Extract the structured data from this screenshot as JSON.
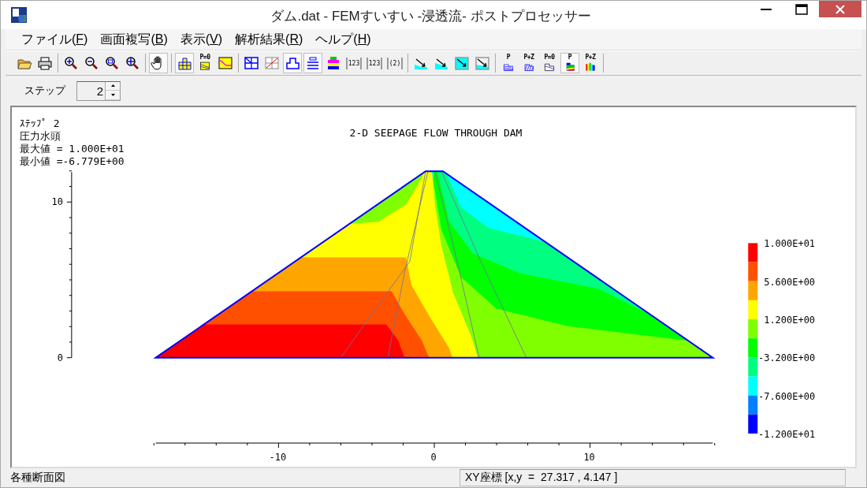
{
  "window": {
    "title": "ダム.dat - FEMすいすい -浸透流- ポストプロセッサー"
  },
  "menu": [
    {
      "before": "ファイル(",
      "key": "F",
      "after": ")"
    },
    {
      "before": "画面複写(",
      "key": "B",
      "after": ")"
    },
    {
      "before": "表示(",
      "key": "V",
      "after": ")"
    },
    {
      "before": "解析結果(",
      "key": "R",
      "after": ")"
    },
    {
      "before": "ヘルプ(",
      "key": "H",
      "after": ")"
    }
  ],
  "toolbar": [
    [
      {
        "kind": "open",
        "pressed": false
      },
      {
        "kind": "print",
        "pressed": false
      }
    ],
    [
      {
        "kind": "zoom-in",
        "pressed": false
      },
      {
        "kind": "zoom-out",
        "pressed": false
      },
      {
        "kind": "zoom-box",
        "pressed": false
      },
      {
        "kind": "zoom-fit",
        "pressed": false
      }
    ],
    [
      {
        "kind": "pan",
        "pressed": true
      }
    ],
    [
      {
        "kind": "mesh",
        "pressed": true
      },
      {
        "kind": "section",
        "label": "P=0",
        "pressed": false
      },
      {
        "kind": "graph",
        "pressed": false
      }
    ],
    [
      {
        "kind": "grid",
        "pressed": false
      },
      {
        "kind": "crossed-grid",
        "pressed": false
      },
      {
        "kind": "outline",
        "pressed": true
      },
      {
        "kind": "layers",
        "pressed": true
      },
      {
        "kind": "color-layers",
        "pressed": false
      },
      {
        "kind": "numbers",
        "label": "123",
        "pressed": false
      },
      {
        "kind": "numbers",
        "label": "123",
        "pressed": false
      },
      {
        "kind": "numbers",
        "label": "(2)",
        "pressed": false
      }
    ],
    [
      {
        "kind": "flow",
        "pressed": false
      },
      {
        "kind": "flow",
        "pressed": false
      },
      {
        "kind": "flow",
        "pressed": false
      },
      {
        "kind": "flow",
        "pressed": false
      }
    ],
    [
      {
        "kind": "hatch",
        "label": "P",
        "pressed": false
      },
      {
        "kind": "stripes",
        "label": "P+Z",
        "pressed": false
      },
      {
        "kind": "phreatic",
        "label": "P=0",
        "pressed": false
      },
      {
        "kind": "contour",
        "label": "P",
        "pressed": true
      },
      {
        "kind": "rainbow",
        "label": "P+Z",
        "pressed": false
      }
    ]
  ],
  "step": {
    "label": "ステップ",
    "value": "2"
  },
  "plot": {
    "info": [
      "ｽﾃｯﾌﾟ 2",
      "圧力水頭",
      "最大値 = 1.000E+01",
      "最小値 =-6.779E+00"
    ],
    "title": "2-D SEEPAGE FLOW THROUGH DAM",
    "y_tick_labels": [
      "10",
      "0"
    ],
    "x_tick_labels": [
      "-10",
      "0",
      "10"
    ]
  },
  "legend": {
    "bands": [
      {
        "color": "#ff0000"
      },
      {
        "color": "#ff5000"
      },
      {
        "color": "#ffa500"
      },
      {
        "color": "#ffff00"
      },
      {
        "color": "#80ff00"
      },
      {
        "color": "#00ff00"
      },
      {
        "color": "#00ff80"
      },
      {
        "color": "#00ffff"
      },
      {
        "color": "#0080ff"
      },
      {
        "color": "#0000ff"
      }
    ],
    "labels": [
      "1.000E+01",
      "5.600E+00",
      "1.200E+00",
      "-3.200E+00",
      "-7.600E+00",
      "-1.200E+01"
    ]
  },
  "status_bar": {
    "message": "各種断面図",
    "coords": "XY座標 [x,y  =  27.317 , 4.147 ]"
  }
}
